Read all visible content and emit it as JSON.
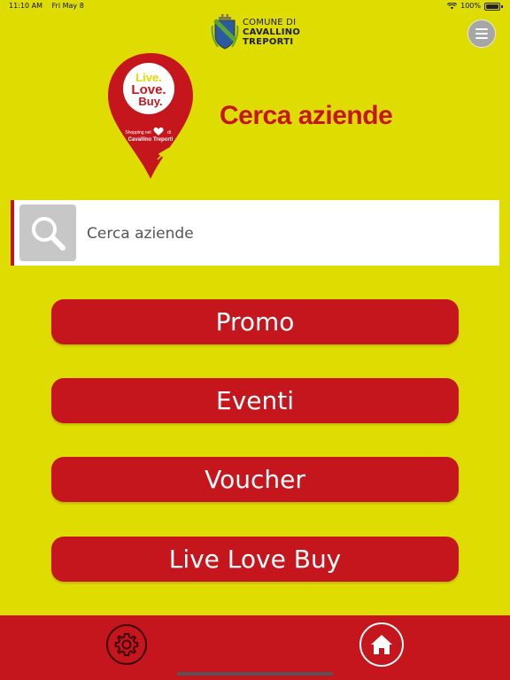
{
  "status_bar": {
    "time": "11:10 AM",
    "date": "Fri May 8",
    "battery": "100%"
  },
  "header": {
    "org_line1": "COMUNE DI",
    "org_line2": "CAVALLINO",
    "org_line3": "TREPORTI"
  },
  "logo": {
    "line1": "Live.",
    "line2": "Love.",
    "line3": "Buy.",
    "tagline": "Shopping nel",
    "tagline_suffix": "di",
    "place": "Cavallino Treporti"
  },
  "page": {
    "title": "Cerca aziende"
  },
  "search": {
    "placeholder": "Cerca aziende"
  },
  "menu": {
    "promo": "Promo",
    "eventi": "Eventi",
    "voucher": "Voucher",
    "live_love_buy": "Live Love Buy"
  },
  "colors": {
    "background": "#dedc00",
    "accent_red": "#c5161d",
    "search_icon_bg": "#c7c7c7"
  },
  "icons": {
    "menu": "hamburger-icon",
    "search": "search-icon",
    "settings": "gear-icon",
    "home": "home-icon"
  }
}
